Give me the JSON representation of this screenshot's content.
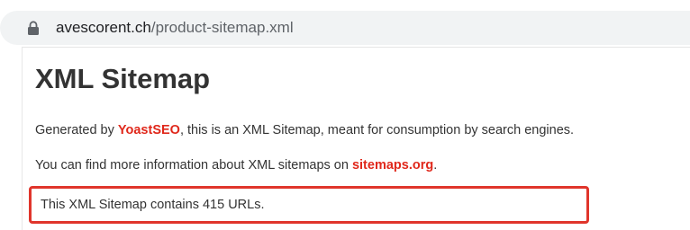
{
  "browser": {
    "url_host": "avescorent.ch",
    "url_path": "/product-sitemap.xml",
    "lock_icon": "lock-icon"
  },
  "page": {
    "title": "XML Sitemap",
    "intro": {
      "prefix": "Generated by ",
      "link_text": "YoastSEO",
      "suffix": ", this is an XML Sitemap, meant for consumption by search engines."
    },
    "more_info": {
      "prefix": "You can find more information about XML sitemaps on ",
      "link_text": "sitemaps.org",
      "suffix": "."
    },
    "url_count_text": "This XML Sitemap contains 415 URLs."
  },
  "colors": {
    "link": "#e0281b",
    "highlight_border": "#e0352b",
    "address_bar_bg": "#f1f3f4"
  }
}
